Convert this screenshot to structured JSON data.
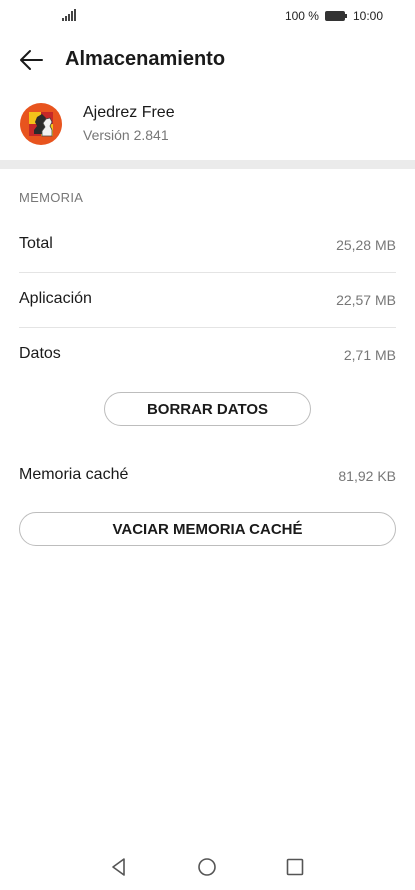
{
  "status_bar": {
    "battery_percent": "100 %",
    "time": "10:00",
    "signal_icon": "signal-icon",
    "battery_icon": "battery-icon"
  },
  "app_bar": {
    "title": "Almacenamiento",
    "back_icon": "arrow-left-icon"
  },
  "app": {
    "name": "Ajedrez Free",
    "version": "Versión 2.841",
    "icon": "chess-knight-icon"
  },
  "memory": {
    "section_label": "MEMORIA",
    "rows": [
      {
        "label": "Total",
        "value": "25,28 MB"
      },
      {
        "label": "Aplicación",
        "value": "22,57 MB"
      },
      {
        "label": "Datos",
        "value": "2,71 MB"
      }
    ],
    "clear_data_button": "BORRAR DATOS",
    "cache_label": "Memoria caché",
    "cache_value": "81,92 KB",
    "clear_cache_button": "VACIAR MEMORIA CACHÉ"
  },
  "nav_bar": {
    "back": "triangle-back-icon",
    "home": "circle-home-icon",
    "recents": "square-recents-icon"
  }
}
